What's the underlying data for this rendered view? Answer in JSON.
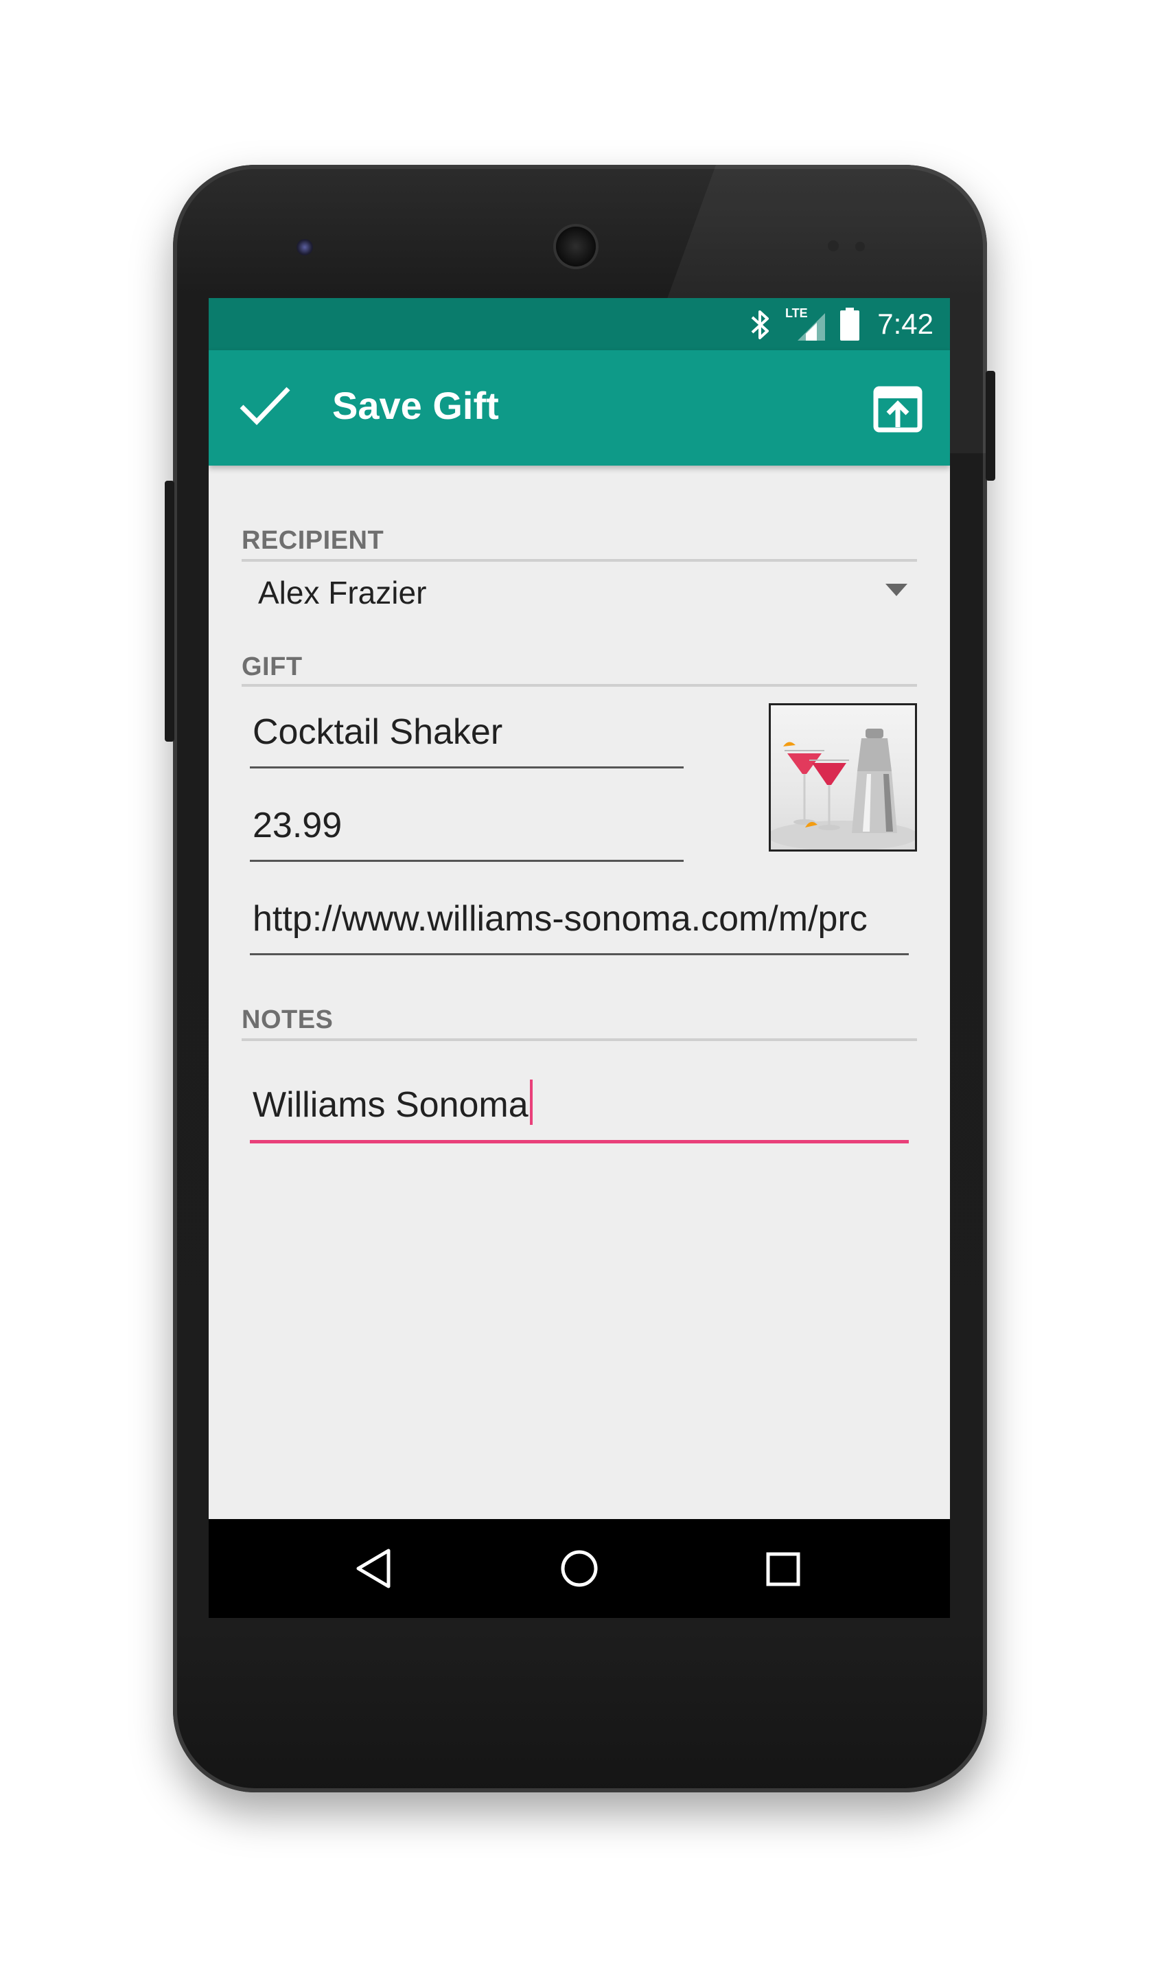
{
  "status": {
    "time": "7:42",
    "network": "LTE",
    "icons": [
      "bluetooth-icon",
      "signal-icon",
      "battery-icon"
    ]
  },
  "appbar": {
    "title": "Save Gift",
    "confirm_icon": "check-icon",
    "share_icon": "share-upload-icon"
  },
  "form": {
    "recipient": {
      "label": "RECIPIENT",
      "value": "Alex Frazier"
    },
    "gift": {
      "label": "GIFT",
      "name": "Cocktail Shaker",
      "price": "23.99",
      "url": "http://www.williams-sonoma.com/m/prc",
      "image": "cocktail-shaker-photo"
    },
    "notes": {
      "label": "NOTES",
      "value": "Williams Sonoma"
    }
  },
  "navigation": {
    "back": "back-triangle-icon",
    "home": "home-circle-icon",
    "recents": "recents-square-icon"
  },
  "colors": {
    "accent": "#0e9a88",
    "statusbar": "#0a7c6c",
    "focus": "#e9407a"
  }
}
